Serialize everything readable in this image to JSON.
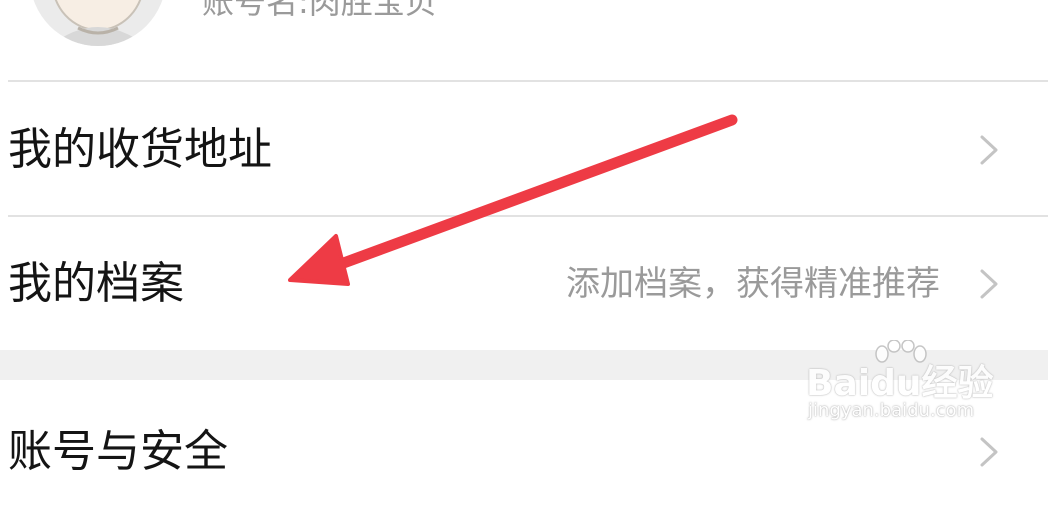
{
  "profile": {
    "account_name": "账号名:肉胜宝贝"
  },
  "menu": {
    "items": [
      {
        "label": "我的收货地址",
        "hint": ""
      },
      {
        "label": "我的档案",
        "hint": "添加档案，获得精准推荐"
      },
      {
        "label": "账号与安全",
        "hint": ""
      }
    ]
  },
  "watermark": {
    "brand": "Baidu经验",
    "url": "jingyan.baidu.com"
  },
  "colors": {
    "annotation_arrow": "#ee3b45",
    "divider": "#e2e2e2",
    "section_gap": "#f0f0f0",
    "label_text": "#141414",
    "hint_text": "#9a9a9a"
  },
  "icons": {
    "chevron": "chevron-right-icon",
    "avatar": "cartoon-avatar"
  }
}
